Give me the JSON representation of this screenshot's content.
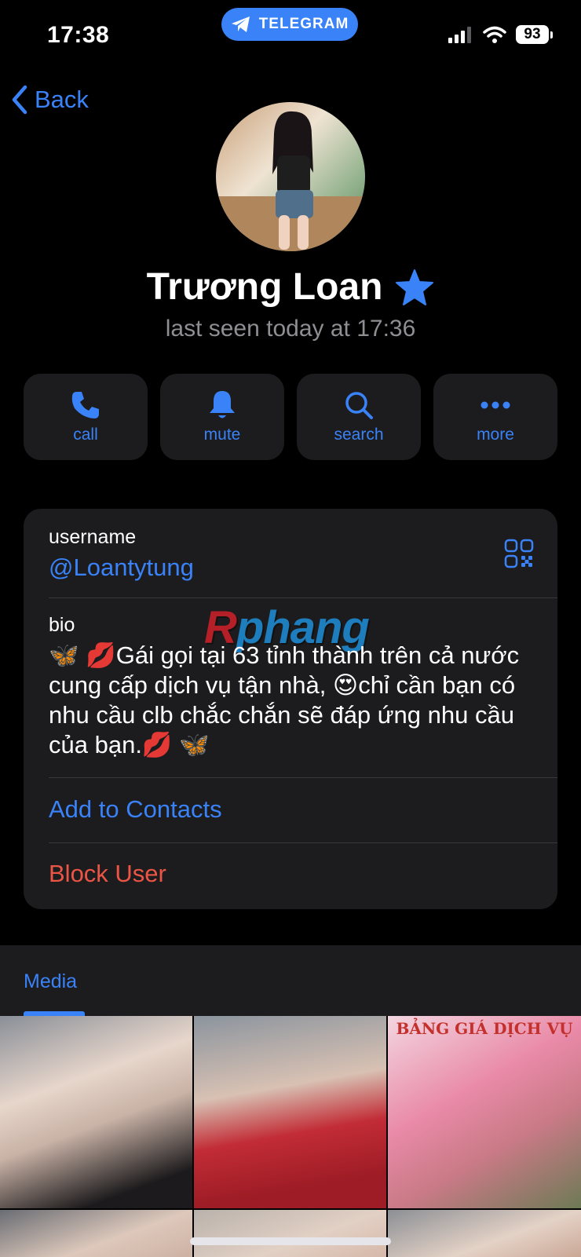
{
  "status_bar": {
    "time": "17:38",
    "pill_label": "TELEGRAM",
    "battery": "93"
  },
  "nav": {
    "back_label": "Back"
  },
  "profile": {
    "name": "Trương Loan",
    "last_seen": "last seen today at 17:36"
  },
  "actions": [
    {
      "label": "call",
      "icon": "phone-icon"
    },
    {
      "label": "mute",
      "icon": "bell-icon"
    },
    {
      "label": "search",
      "icon": "search-icon"
    },
    {
      "label": "more",
      "icon": "ellipsis-icon"
    }
  ],
  "info": {
    "username_label": "username",
    "username_value": "@Loantytung",
    "bio_label": "bio",
    "bio_text": "🦋 💋Gái gọi tại 63 tỉnh thành trên cả nước cung cấp dịch vụ tận nhà, 😍chỉ cần bạn có nhu cầu clb chắc chắn sẽ đáp ứng nhu cầu của bạn.💋 🦋",
    "add_contacts": "Add to Contacts",
    "block_user": "Block User"
  },
  "watermark": {
    "text_r": "R",
    "text_rest": "phang"
  },
  "media": {
    "tab_label": "Media",
    "price_sheet_title": "BẢNG GIÁ DỊCH VỤ"
  },
  "colors": {
    "accent": "#3a82f7",
    "danger": "#eb5545",
    "card": "#1c1c1e",
    "background": "#000000"
  }
}
